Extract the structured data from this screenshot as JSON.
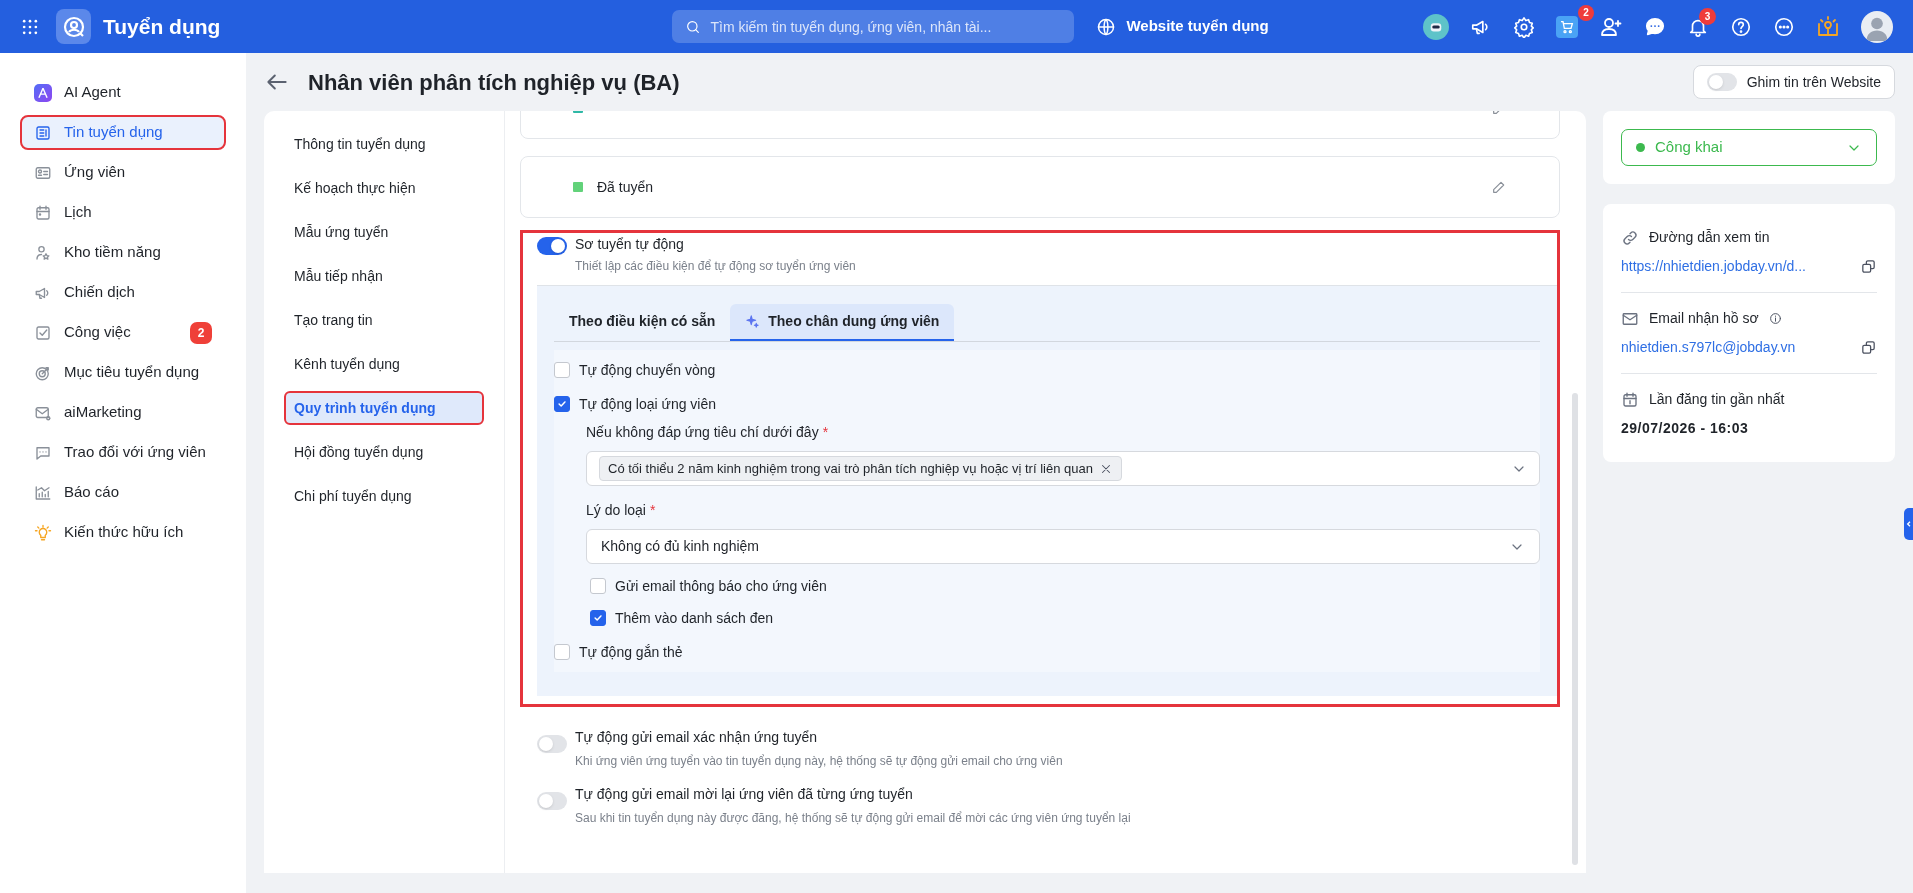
{
  "topbar": {
    "app_title": "Tuyển dụng",
    "search": {
      "placeholder": "Tìm kiếm tin tuyển dụng, ứng viên, nhân tài..."
    },
    "website_link": "Website tuyển dụng",
    "cart_badge": "2",
    "notification_badge": "3"
  },
  "sidebar": {
    "items": [
      {
        "label": "AI Agent",
        "selected": false,
        "highlighted": false
      },
      {
        "label": "Tin tuyển dụng",
        "selected": true,
        "highlighted": true
      },
      {
        "label": "Ứng viên",
        "selected": false,
        "highlighted": false
      },
      {
        "label": "Lịch",
        "selected": false,
        "highlighted": false
      },
      {
        "label": "Kho tiềm năng",
        "selected": false,
        "highlighted": false
      },
      {
        "label": "Chiến dịch",
        "selected": false,
        "highlighted": false
      },
      {
        "label": "Công việc",
        "selected": false,
        "highlighted": false,
        "badge": "2"
      },
      {
        "label": "Mục tiêu tuyển dụng",
        "selected": false,
        "highlighted": false
      },
      {
        "label": "aiMarketing",
        "selected": false,
        "highlighted": false
      },
      {
        "label": "Trao đổi với ứng viên",
        "selected": false,
        "highlighted": false
      },
      {
        "label": "Báo cáo",
        "selected": false,
        "highlighted": false
      },
      {
        "label": "Kiến thức hữu ích",
        "selected": false,
        "highlighted": false
      }
    ]
  },
  "page": {
    "title": "Nhân viên phân tích nghiệp vụ (BA)",
    "pin": {
      "label": "Ghim tin trên Website",
      "on": false
    }
  },
  "nav": {
    "items": [
      {
        "label": "Thông tin tuyển dụng",
        "selected": false,
        "highlighted": false
      },
      {
        "label": "Kế hoạch thực hiện",
        "selected": false,
        "highlighted": false
      },
      {
        "label": "Mẫu ứng tuyển",
        "selected": false,
        "highlighted": false
      },
      {
        "label": "Mẫu tiếp nhận",
        "selected": false,
        "highlighted": false
      },
      {
        "label": "Tạo trang tin",
        "selected": false,
        "highlighted": false
      },
      {
        "label": "Kênh tuyển dụng",
        "selected": false,
        "highlighted": false
      },
      {
        "label": "Quy trình tuyển dụng",
        "selected": true,
        "highlighted": true
      },
      {
        "label": "Hội đồng tuyển dụng",
        "selected": false,
        "highlighted": false
      },
      {
        "label": "Chi phí tuyển dụng",
        "selected": false,
        "highlighted": false
      }
    ]
  },
  "stages": [
    {
      "color": "#2fb8a6"
    },
    {
      "label": "Đã tuyển",
      "color": "#62d27a"
    }
  ],
  "auto_screening": {
    "on": true,
    "highlighted": true,
    "title": "Sơ tuyển tự động",
    "description": "Thiết lập các điều kiện để tự động sơ tuyển ứng viên",
    "tabs": [
      {
        "label": "Theo điều kiện có sẵn",
        "selected": false
      },
      {
        "label": "Theo chân dung ứng viên",
        "selected": true
      }
    ],
    "options": [
      {
        "label": "Tự động chuyển vòng",
        "checked": false
      },
      {
        "label": "Tự động loại ứng viên",
        "checked": true,
        "criteria": {
          "label": "Nếu không đáp ứng tiêu chí dưới đây",
          "required_mark": "*",
          "tags": [
            "Có tối thiểu 2 năm kinh nghiệm trong vai trò phân tích nghiệp vụ hoặc vị trí liên quan"
          ]
        },
        "reason": {
          "label": "Lý do loại",
          "required_mark": "*",
          "value": "Không có đủ kinh nghiệm"
        },
        "sub_options": [
          {
            "label": "Gửi email thông báo cho ứng viên",
            "checked": false
          },
          {
            "label": "Thêm vào danh sách đen",
            "checked": true
          }
        ]
      },
      {
        "label": "Tự động gắn thẻ",
        "checked": false
      }
    ]
  },
  "email_settings": [
    {
      "title": "Tự động gửi email xác nhận ứng tuyển",
      "description": "Khi ứng viên ứng tuyển vào tin tuyển dụng này, hệ thống sẽ tự động gửi email cho ứng viên",
      "on": false
    },
    {
      "title": "Tự động gửi email mời lại ứng viên đã từng ứng tuyển",
      "description": "Sau khi tin tuyển dụng này được đăng, hệ thống sẽ tự động gửi email để mời các ứng viên ứng tuyển lại",
      "on": false
    }
  ],
  "status": {
    "label": "Công khai",
    "color": "#3cb94e"
  },
  "info": [
    {
      "kind": "link",
      "label": "Đường dẫn xem tin",
      "value": "https://nhietdien.jobday.vn/d..."
    },
    {
      "kind": "email",
      "label": "Email nhận hồ sơ",
      "info_icon": true,
      "value": "nhietdien.s797lc@jobday.vn"
    },
    {
      "kind": "date",
      "label": "Lần đăng tin gần nhất",
      "value": "29/07/2026 - 16:03"
    }
  ]
}
